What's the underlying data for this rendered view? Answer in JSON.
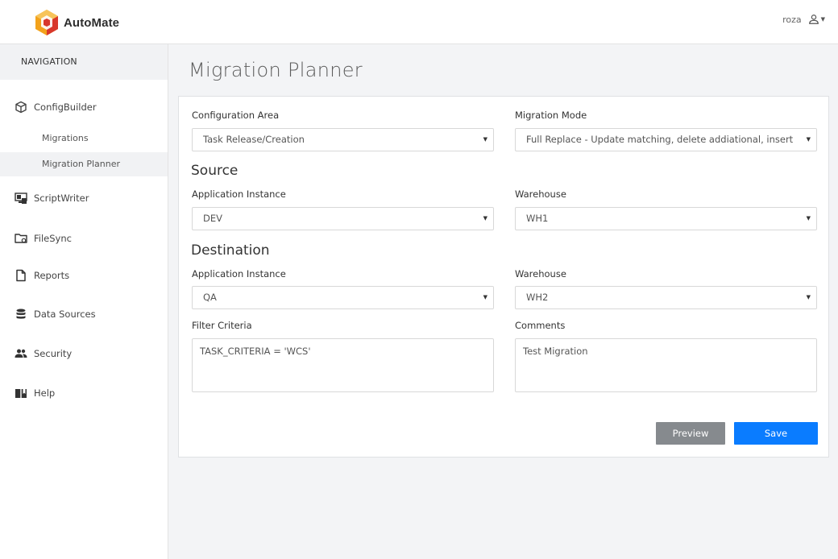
{
  "app": {
    "name": "AutoMate",
    "user": "roza"
  },
  "colors": {
    "accent": "#0a7cff",
    "secondary_button": "#868a8e",
    "logo_red": "#d8372b",
    "logo_orange": "#f3a21b"
  },
  "sidebar": {
    "title": "NAVIGATION",
    "items": [
      {
        "label": "ConfigBuilder",
        "icon": "cube-icon"
      },
      {
        "label": "ScriptWriter",
        "icon": "monitor-code-icon"
      },
      {
        "label": "FileSync",
        "icon": "folder-sync-icon"
      },
      {
        "label": "Reports",
        "icon": "file-icon"
      },
      {
        "label": "Data Sources",
        "icon": "database-icon"
      },
      {
        "label": "Security",
        "icon": "users-icon"
      },
      {
        "label": "Help",
        "icon": "book-icon"
      }
    ],
    "subitems": [
      {
        "label": "Migrations",
        "active": false
      },
      {
        "label": "Migration Planner",
        "active": true
      }
    ]
  },
  "page": {
    "title": "Migration Planner"
  },
  "form": {
    "config_area": {
      "label": "Configuration Area",
      "value": "Task Release/Creation"
    },
    "migration_mode": {
      "label": "Migration Mode",
      "value": "Full Replace - Update matching, delete addiational, insert"
    },
    "source": {
      "heading": "Source",
      "app_instance": {
        "label": "Application Instance",
        "value": "DEV"
      },
      "warehouse": {
        "label": "Warehouse",
        "value": "WH1"
      }
    },
    "destination": {
      "heading": "Destination",
      "app_instance": {
        "label": "Application Instance",
        "value": "QA"
      },
      "warehouse": {
        "label": "Warehouse",
        "value": "WH2"
      }
    },
    "filter_criteria": {
      "label": "Filter Criteria",
      "value": "TASK_CRITERIA = 'WCS'"
    },
    "comments": {
      "label": "Comments",
      "value": "Test Migration"
    },
    "select_arrow": "▼",
    "buttons": {
      "preview": "Preview",
      "save": "Save"
    }
  }
}
